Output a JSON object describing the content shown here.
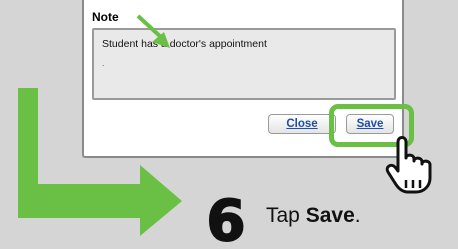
{
  "dialog": {
    "note_label": "Note",
    "note_value": "Student has a doctor's appointment",
    "note_cursor": ".",
    "close_label": "Close",
    "save_label": "Save"
  },
  "instruction": {
    "step_number": "6",
    "text_prefix": "Tap ",
    "text_action": "Save",
    "text_suffix": "."
  },
  "colors": {
    "highlight_green": "#6abf45",
    "link_blue": "#1f4fa8"
  },
  "icons": [
    "pointing-hand-icon",
    "arrow-icon"
  ]
}
